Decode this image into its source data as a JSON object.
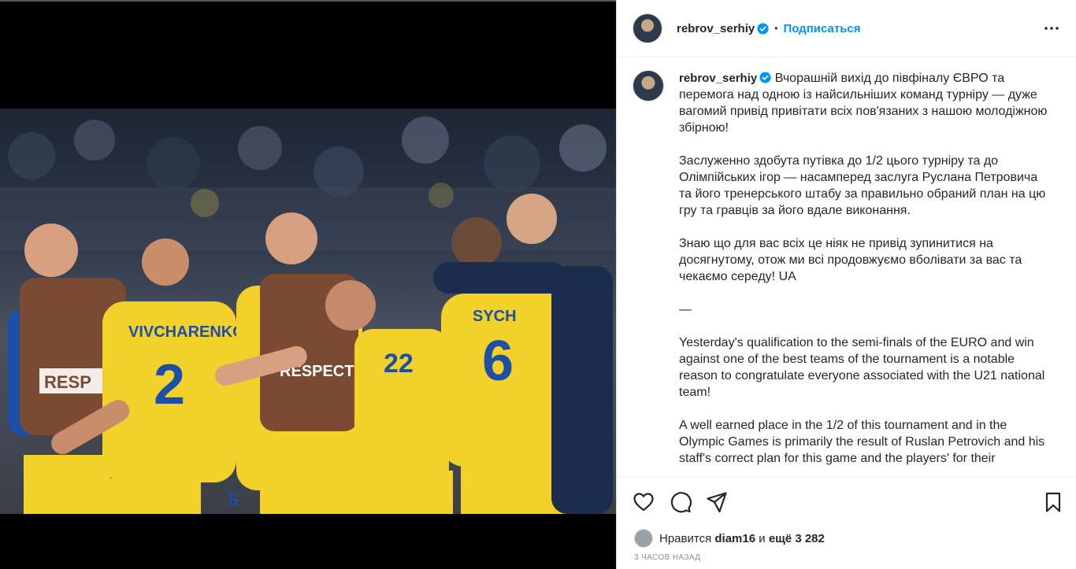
{
  "post": {
    "username": "rebrov_serhiy",
    "follow_label": "Подписаться",
    "separator": "•",
    "caption_ua_1": "Вчорашній вихід до півфіналу ЄВРО та перемога над одною із найсильніших команд турніру — дуже вагомий привід привітати всіх пов'язаних з нашою молодіжною збірною!",
    "caption_ua_2": "Заслуженно здобута путівка до 1/2 цього турніру та до Олімпійських ігор — насамперед заслуга Руслана Петровича та його тренерського штабу за правильно обраний план на цю гру та гравців за його вдале виконання.",
    "caption_ua_3": "Знаю що для вас всіх це ніяк не привід зупинитися на досягнутому, отож ми всі продовжуємо вболівати за вас та чекаємо середу! UA",
    "caption_dash": "—",
    "caption_en_1": "Yesterday's qualification to the semi-finals of the EURO and win against one of the best teams of the tournament is a notable reason to congratulate everyone associated with the U21 national team!",
    "caption_en_2": "A well earned place in the 1/2 of this tournament and in the Olympic Games is primarily the result of Ruslan Petrovich and his staff's correct plan for this game and the players' for their",
    "likes_prefix": "Нравится",
    "likes_user": "diam16",
    "likes_middle": "и",
    "likes_rest": "ещё 3 282",
    "timestamp": "3 ЧАСОВ НАЗАД"
  },
  "photo": {
    "jersey_names": [
      "VIVCHARENKO",
      "SYCH"
    ],
    "jersey_numbers": [
      "2",
      "22",
      "6",
      "5"
    ],
    "board_text": [
      "RESPECT",
      "RESP",
      "RESPECT"
    ]
  },
  "icons": [
    "verified-badge-icon",
    "more-options-icon",
    "heart-icon",
    "comment-icon",
    "share-icon",
    "bookmark-icon"
  ],
  "colors": {
    "accent": "#0095f6",
    "jersey_yellow": "#f2d12b",
    "jersey_blue": "#1c4fa8",
    "bib_brown": "#7a4a32"
  }
}
